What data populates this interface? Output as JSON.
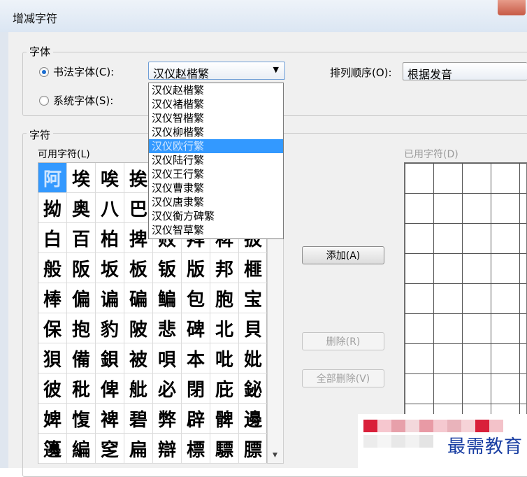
{
  "window": {
    "title": "增减字符"
  },
  "font_group": {
    "label": "字体",
    "calligraphy_radio": "书法字体(C):",
    "system_radio": "系统字体(S):",
    "font_combo_value": "汉仪赵楷繁",
    "sort_label": "排列顺序(O):",
    "sort_combo_value": "根据发音",
    "dropdown_options": [
      "汉仪赵楷繁",
      "汉仪褚楷繁",
      "汉仪智楷繁",
      "汉仪柳楷繁",
      "汉仪欧行繁",
      "汉仪陆行繁",
      "汉仪王行繁",
      "汉仪曹隶繁",
      "汉仪唐隶繁",
      "汉仪衡方碑繁",
      "汉仪智草繁"
    ],
    "dropdown_selected_index": 4
  },
  "char_group": {
    "label": "字符",
    "available_label": "可用字符(L)",
    "used_label": "已用字符(D)",
    "available_chars": [
      "阿",
      "埃",
      "唉",
      "挨",
      "",
      "",
      "",
      "",
      "拗",
      "奥",
      "八",
      "巴",
      "",
      "",
      "",
      "",
      "白",
      "百",
      "柏",
      "捭",
      "败",
      "拜",
      "稗",
      "扳",
      "般",
      "阪",
      "坂",
      "板",
      "钣",
      "版",
      "邦",
      "榧",
      "棒",
      "偏",
      "谝",
      "碥",
      "鳊",
      "包",
      "胞",
      "宝",
      "保",
      "抱",
      "豹",
      "陂",
      "悲",
      "碑",
      "北",
      "貝",
      "狽",
      "備",
      "鋇",
      "被",
      "唄",
      "本",
      "吡",
      "妣",
      "彼",
      "秕",
      "俾",
      "舭",
      "必",
      "閉",
      "庇",
      "鉍",
      "婢",
      "愎",
      "裨",
      "碧",
      "弊",
      "辟",
      "髀",
      "邊",
      "籩",
      "編",
      "窆",
      "扁",
      "辯",
      "標",
      "驃",
      "膘"
    ]
  },
  "buttons": {
    "add": "添加(A)",
    "delete": "删除(R)",
    "delete_all": "全部删除(V)"
  },
  "watermark": {
    "text": "最需教育"
  }
}
